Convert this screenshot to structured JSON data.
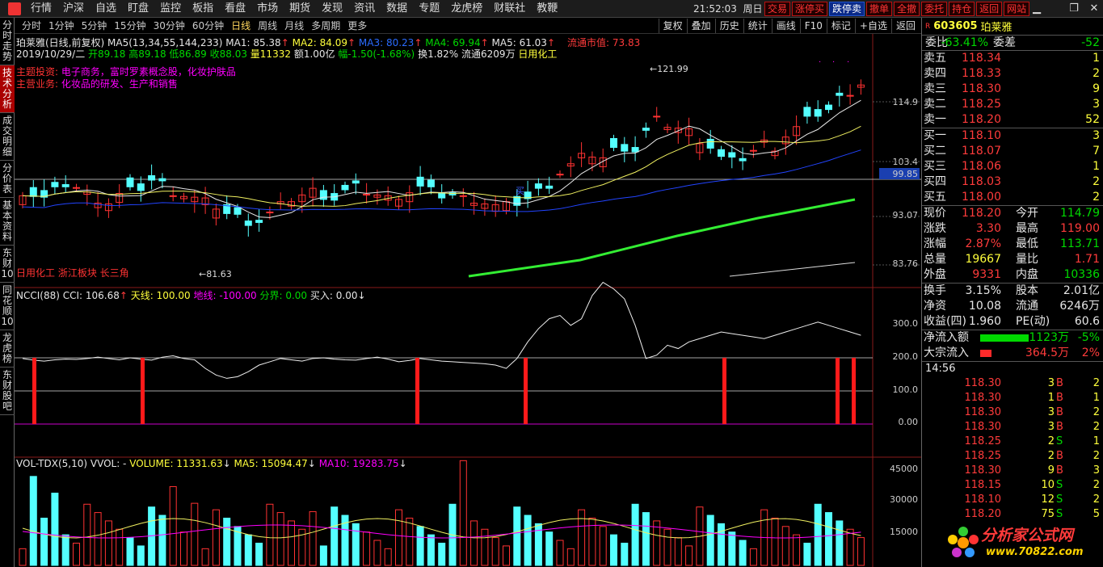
{
  "topbar": {
    "menu": [
      "行情",
      "沪深",
      "自选",
      "盯盘",
      "监控",
      "板指",
      "看盘",
      "市场",
      "期货",
      "发现",
      "资讯",
      "数据",
      "专题",
      "龙虎榜",
      "财联社",
      "教鞭"
    ],
    "time": "21:52:03",
    "weekday": "周日",
    "trade_buttons": [
      "交易",
      "涨停买",
      "跌停卖",
      "撤单",
      "全撤",
      "委托",
      "持仓",
      "返回",
      "网站"
    ]
  },
  "leftbar": [
    "分时走势",
    "技术分析",
    "成交明细",
    "分价表",
    "基本资料",
    "东财10",
    "同花顺10",
    "龙虎榜",
    "东财股吧"
  ],
  "tabs": [
    "分时",
    "1分钟",
    "5分钟",
    "15分钟",
    "30分钟",
    "60分钟",
    "日线",
    "周线",
    "月线",
    "多周期",
    "更多"
  ],
  "selected_tab": "日线",
  "right_buttons": [
    "复权",
    "叠加",
    "历史",
    "统计",
    "画线",
    "F10",
    "标记",
    "+自选",
    "返回"
  ],
  "info": {
    "name": "珀莱雅(日线,前复权)",
    "ma_label": "MA5(13,34,55,144,233)",
    "ma1": "MA1: 85.38",
    "ma2": "MA2: 84.09",
    "ma3": "MA3: 80.23",
    "ma4": "MA4: 69.94",
    "ma5": "MA5: 61.03",
    "market_value": "流通市值: 73.83",
    "date": "2019/10/29/二",
    "open": "开89.18",
    "high": "高89.18",
    "low": "低86.89",
    "close": "收88.03",
    "volume": "量11332",
    "amount": "额1.00亿",
    "change": "幅-1.50(-1.68%)",
    "turnover": "换1.82%",
    "float": "流通6209万",
    "industry": "日用化工",
    "theme_label": "主题投资:",
    "theme_value": "电子商务，富时罗素概念股，化妆护肤品",
    "business_label": "主营业务:",
    "business_value": "化妆品的研发、生产和销售",
    "tags": "日用化工  浙江板块  长三角",
    "price_hi_label": "121.99",
    "price_lo_label": "81.63",
    "mark_label": "买"
  },
  "axis_main": [
    "114.9",
    "103.4",
    "99.85",
    "93.07",
    "83.76"
  ],
  "ncci": {
    "title": "NCCI(88)",
    "cci": "CCI: 106.68",
    "sky": "天线: 100.00",
    "ground": "地线: -100.00",
    "boundary": "分界: 0.00",
    "buy": "买入: 0.00",
    "axis": [
      "300.0",
      "200.0",
      "100.0",
      "0.00"
    ]
  },
  "vol": {
    "title": "VOL-TDX(5,10)",
    "vvol": "VVOL: -",
    "volume": "VOLUME: 11331.63",
    "ma5": "MA5: 15094.47",
    "ma10": "MA10: 19283.75",
    "axis": [
      "45000",
      "30000",
      "15000"
    ]
  },
  "quote": {
    "code": "603605",
    "name": "珀莱雅",
    "wei_bi_label": "委比",
    "wei_bi": "-63.41%",
    "wei_cha_label": "委差",
    "wei_cha": "-52",
    "asks": [
      {
        "label": "卖五",
        "price": "118.34",
        "vol": "1"
      },
      {
        "label": "卖四",
        "price": "118.33",
        "vol": "2"
      },
      {
        "label": "卖三",
        "price": "118.30",
        "vol": "9"
      },
      {
        "label": "卖二",
        "price": "118.25",
        "vol": "3"
      },
      {
        "label": "卖一",
        "price": "118.20",
        "vol": "52"
      }
    ],
    "bids": [
      {
        "label": "买一",
        "price": "118.10",
        "vol": "3"
      },
      {
        "label": "买二",
        "price": "118.07",
        "vol": "7"
      },
      {
        "label": "买三",
        "price": "118.06",
        "vol": "1"
      },
      {
        "label": "买四",
        "price": "118.03",
        "vol": "2"
      },
      {
        "label": "买五",
        "price": "118.00",
        "vol": "2"
      }
    ],
    "stats": [
      {
        "l1": "现价",
        "v1": "118.20",
        "c1": "red",
        "l2": "今开",
        "v2": "114.79",
        "c2": "green"
      },
      {
        "l1": "涨跌",
        "v1": "3.30",
        "c1": "red",
        "l2": "最高",
        "v2": "119.00",
        "c2": "red"
      },
      {
        "l1": "涨幅",
        "v1": "2.87%",
        "c1": "red",
        "l2": "最低",
        "v2": "113.71",
        "c2": "green"
      },
      {
        "l1": "总量",
        "v1": "19667",
        "c1": "yellow",
        "l2": "量比",
        "v2": "1.71",
        "c2": "red"
      },
      {
        "l1": "外盘",
        "v1": "9331",
        "c1": "red",
        "l2": "内盘",
        "v2": "10336",
        "c2": "green"
      }
    ],
    "stats2": [
      {
        "l1": "换手",
        "v1": "3.15%",
        "l2": "股本",
        "v2": "2.01亿"
      },
      {
        "l1": "净资",
        "v1": "10.08",
        "l2": "流通",
        "v2": "6246万"
      },
      {
        "l1": "收益(四)",
        "v1": "1.960",
        "l2": "PE(动)",
        "v2": "60.6"
      }
    ],
    "net_inflow_label": "净流入额",
    "net_inflow": "-1123万",
    "net_inflow_pct": "-5%",
    "block_inflow_label": "大宗流入",
    "block_inflow": "364.5万",
    "block_inflow_pct": "2%",
    "ticks_time": "14:56",
    "ticks": [
      {
        "price": "118.30",
        "vol": "3",
        "side": "B",
        "n": "2"
      },
      {
        "price": "118.30",
        "vol": "1",
        "side": "B",
        "n": "1"
      },
      {
        "price": "118.30",
        "vol": "3",
        "side": "B",
        "n": "2"
      },
      {
        "price": "118.30",
        "vol": "3",
        "side": "B",
        "n": "2"
      },
      {
        "price": "118.25",
        "vol": "2",
        "side": "S",
        "n": "1"
      },
      {
        "price": "118.25",
        "vol": "2",
        "side": "B",
        "n": "2"
      },
      {
        "price": "118.30",
        "vol": "9",
        "side": "B",
        "n": "3"
      },
      {
        "price": "118.15",
        "vol": "10",
        "side": "S",
        "n": "2"
      },
      {
        "price": "118.10",
        "vol": "12",
        "side": "S",
        "n": "2"
      },
      {
        "price": "118.20",
        "vol": "75",
        "side": "S",
        "n": "5"
      }
    ]
  },
  "watermark": {
    "line1": "分析家公式网",
    "line2": "www.70822.com"
  }
}
